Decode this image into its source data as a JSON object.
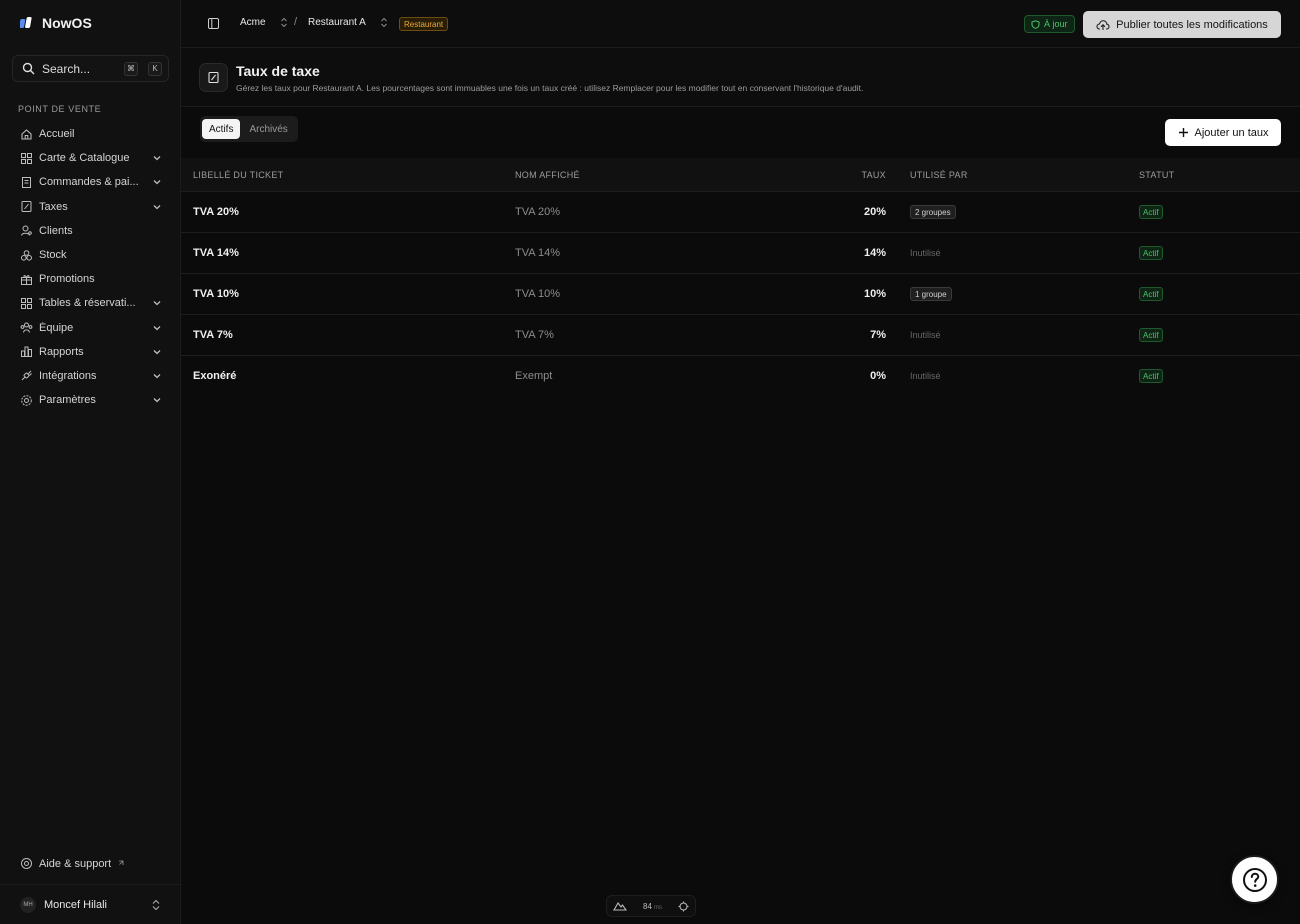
{
  "app": {
    "name": "NowOS"
  },
  "search": {
    "placeholder": "Search...",
    "shortcut_1": "⌘",
    "shortcut_2": "K"
  },
  "sidebar": {
    "section": "POINT DE VENTE",
    "items": [
      {
        "label": "Accueil",
        "icon": "home-icon",
        "expandable": false
      },
      {
        "label": "Carte & Catalogue",
        "icon": "grid-icon",
        "expandable": true
      },
      {
        "label": "Commandes & pai...",
        "icon": "receipt-icon",
        "expandable": true
      },
      {
        "label": "Taxes",
        "icon": "tax-icon",
        "expandable": true
      },
      {
        "label": "Clients",
        "icon": "user-icon",
        "expandable": false
      },
      {
        "label": "Stock",
        "icon": "boxes-icon",
        "expandable": false
      },
      {
        "label": "Promotions",
        "icon": "gift-icon",
        "expandable": false
      },
      {
        "label": "Tables & réservati...",
        "icon": "grid-icon",
        "expandable": true
      },
      {
        "label": "Équipe",
        "icon": "team-icon",
        "expandable": true
      },
      {
        "label": "Rapports",
        "icon": "chart-icon",
        "expandable": true
      },
      {
        "label": "Intégrations",
        "icon": "plug-icon",
        "expandable": true
      },
      {
        "label": "Paramètres",
        "icon": "gear-icon",
        "expandable": true
      }
    ],
    "help": "Aide & support",
    "user": {
      "initials": "MH",
      "name": "Moncef Hilali"
    }
  },
  "topbar": {
    "org": "Acme",
    "separator": "/",
    "location": "Restaurant A",
    "location_badge": "Restaurant",
    "status": "À jour",
    "publish": "Publier toutes les modifications"
  },
  "page": {
    "title": "Taux de taxe",
    "description": "Gérez les taux pour Restaurant A. Les pourcentages sont immuables une fois un taux créé : utilisez Remplacer pour les modifier tout en conservant l'historique d'audit."
  },
  "tabs": {
    "active": "Actifs",
    "archived": "Archivés"
  },
  "add_button": "Ajouter un taux",
  "table": {
    "headers": {
      "label": "LIBELLÉ DU TICKET",
      "name": "NOM AFFICHÉ",
      "rate": "TAUX",
      "used_by": "UTILISÉ PAR",
      "status": "STATUT"
    },
    "rows": [
      {
        "label": "TVA 20%",
        "name": "TVA 20%",
        "rate": "20%",
        "used_by": "2 groupes",
        "used": true,
        "status": "Actif"
      },
      {
        "label": "TVA 14%",
        "name": "TVA 14%",
        "rate": "14%",
        "used_by": "Inutilisé",
        "used": false,
        "status": "Actif"
      },
      {
        "label": "TVA 10%",
        "name": "TVA 10%",
        "rate": "10%",
        "used_by": "1 groupe",
        "used": true,
        "status": "Actif"
      },
      {
        "label": "TVA 7%",
        "name": "TVA 7%",
        "rate": "7%",
        "used_by": "Inutilisé",
        "used": false,
        "status": "Actif"
      },
      {
        "label": "Exonéré",
        "name": "Exempt",
        "rate": "0%",
        "used_by": "Inutilisé",
        "used": false,
        "status": "Actif"
      }
    ]
  },
  "perf": {
    "value": "84",
    "unit": "ms"
  },
  "colors": {
    "accent_green": "#4ec26a",
    "badge_amber": "#e7a93c",
    "publish_bg": "#d6d6d6"
  }
}
